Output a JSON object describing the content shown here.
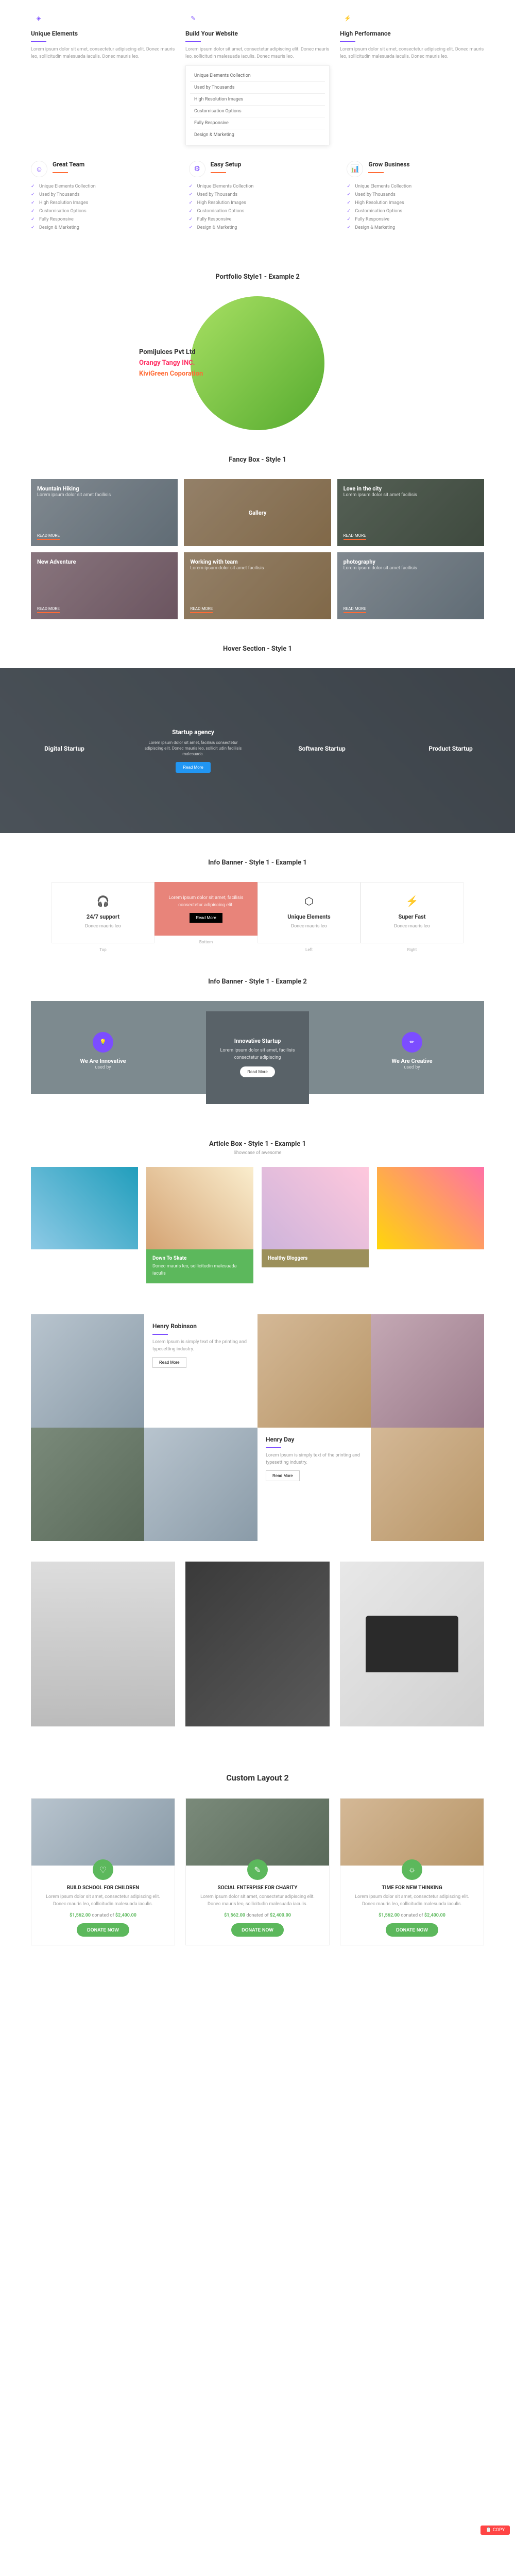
{
  "top_features": [
    {
      "icon": "layers",
      "title": "Unique Elements",
      "desc": "Lorem ipsum dolor sit amet, consectetur adipiscing elit. Donec mauris leo, sollicitudin malesuada iaculis. Donec mauris leo."
    },
    {
      "icon": "wand",
      "title": "Build Your Website",
      "desc": "Lorem ipsum dolor sit amet, consectetur adipiscing elit. Donec mauris leo, sollicitudin malesuada iaculis. Donec mauris leo."
    },
    {
      "icon": "bolt",
      "title": "High Performance",
      "desc": "Lorem ipsum dolor sit amet, consectetur adipiscing elit. Donec mauris leo, sollicitudin malesuada iaculis. Donec mauris leo."
    }
  ],
  "dropdown_items": [
    "Unique Elements Collection",
    "Used by Thousands",
    "High Resolution Images",
    "Customisation Options",
    "Fully Responsive",
    "Design & Marketing"
  ],
  "list_cols": [
    {
      "icon": "users",
      "title": "Great Team",
      "items": [
        "Unique Elements Collection",
        "Used by Thousands",
        "High Resolution Images",
        "Customisation Options",
        "Fully Responsive",
        "Design & Marketing"
      ]
    },
    {
      "icon": "gear",
      "title": "Easy Setup",
      "items": [
        "Unique Elements Collection",
        "Used by Thousands",
        "High Resolution Images",
        "Customisation Options",
        "Fully Responsive",
        "Design & Marketing"
      ]
    },
    {
      "icon": "chart",
      "title": "Grow Business",
      "items": [
        "Unique Elements Collection",
        "Used by Thousands",
        "High Resolution Images",
        "Customisation Options",
        "Fully Responsive",
        "Design & Marketing"
      ]
    }
  ],
  "portfolio_title": "Portfolio Style1 - Example 2",
  "brands": {
    "b1": "Pomijuices Pvt Ltd",
    "b2": "Orangy Tangy INC.",
    "b3": "KiviGreen Coporation"
  },
  "fancy_title": "Fancy Box - Style 1",
  "fancy_items": [
    {
      "title": "Mountain Hiking",
      "desc": "Lorem ipsum dolor sit amet facilisis",
      "btn": "READ MORE"
    },
    {
      "title": "Gallery",
      "desc": "",
      "btn": ""
    },
    {
      "title": "Love in the city",
      "desc": "Lorem ipsum dolor sit amet facilisis",
      "btn": "READ MORE"
    },
    {
      "title": "New Adventure",
      "desc": "Lorem ipsum dolor sit amet facilisis",
      "btn": "READ MORE"
    },
    {
      "title": "Working with team",
      "desc": "Lorem ipsum dolor sit amet facilisis",
      "btn": "READ MORE"
    },
    {
      "title": "photography",
      "desc": "Lorem ipsum dolor sit amet facilisis",
      "btn": "READ MORE"
    }
  ],
  "hover_title": "Hover Section - Style 1",
  "hero": [
    {
      "title": "Digital Startup",
      "desc": ""
    },
    {
      "title": "Startup agency",
      "desc": "Lorem ipsum dolor sit amet, facilisis consectetur adipiscing elit. Donec mauris leo, sollicit udin facilisis malesuada.",
      "btn": "Read More"
    },
    {
      "title": "Software Startup",
      "desc": ""
    },
    {
      "title": "Product Startup",
      "desc": ""
    }
  ],
  "info1_title": "Info Banner - Style 1 - Example 1",
  "info1": {
    "cards": [
      {
        "icon": "🎧",
        "title": "24/7 support",
        "desc": "Donec mauris leo",
        "label": "Top"
      },
      {
        "icon": "",
        "title": "",
        "desc": "Lorem ipsum dolor sit amet, facilisis consectetur adipiscing elit.",
        "btn": "Read More",
        "label": "Bottom",
        "highlight": true
      },
      {
        "icon": "⬡",
        "title": "Unique Elements",
        "desc": "Donec mauris leo",
        "label": "Left"
      },
      {
        "icon": "⚡",
        "title": "Super Fast",
        "desc": "Donec mauris leo",
        "label": "Right"
      }
    ]
  },
  "info2_title": "Info Banner - Style 1 - Example 2",
  "inno": {
    "left": {
      "title": "We Are Innovative",
      "sub": "used by"
    },
    "center": {
      "title": "Innovative Startup",
      "desc": "Lorem ipsum dolor sit amet, facilisis consectetur adipiscing",
      "btn": "Read More"
    },
    "right": {
      "title": "We Are Creative",
      "sub": "used by"
    }
  },
  "article_title": "Article Box - Style 1 - Example 1",
  "article_sub": "Showcase of awesome",
  "articles": [
    {
      "title": "Down To Skate",
      "desc": "Donec mauris leo, sollicitudin malesuada iaculis"
    },
    {
      "title": "Healthy Bloggers",
      "desc": ""
    }
  ],
  "team": [
    {
      "name": "Henry Robinson",
      "desc": "Lorem Ipsum is simply text of the printing and typesetting industry.",
      "btn": "Read More"
    },
    {
      "name": "Henry Day",
      "desc": "Lorem Ipsum is simply text of the printing and typesetting industry.",
      "btn": "Read More"
    }
  ],
  "cl2_title": "Custom Layout 2",
  "donate": [
    {
      "title": "BUILD SCHOOL FOR CHILDREN",
      "desc": "Lorem ipsum dolor sit amet, consectetur adipiscing elit. Donec mauris leo, sollicitudin malesuada iaculis.",
      "raised": "$1,562.00",
      "goal": "$2,400.00",
      "btn": "DONATE NOW"
    },
    {
      "title": "SOCIAL ENTERPISE FOR CHARITY",
      "desc": "Lorem ipsum dolor sit amet, consectetur adipiscing elit. Donec mauris leo, sollicitudin malesuada iaculis.",
      "raised": "$1,562.00",
      "goal": "$2,400.00",
      "btn": "DONATE NOW"
    },
    {
      "title": "TIME FOR NEW THINKING",
      "desc": "Lorem ipsum dolor sit amet, consectetur adipiscing elit. Donec mauris leo, sollicitudin malesuada iaculis.",
      "raised": "$1,562.00",
      "goal": "$2,400.00",
      "btn": "DONATE NOW"
    }
  ],
  "donate_word": "donated of",
  "copy_label": "COPY"
}
